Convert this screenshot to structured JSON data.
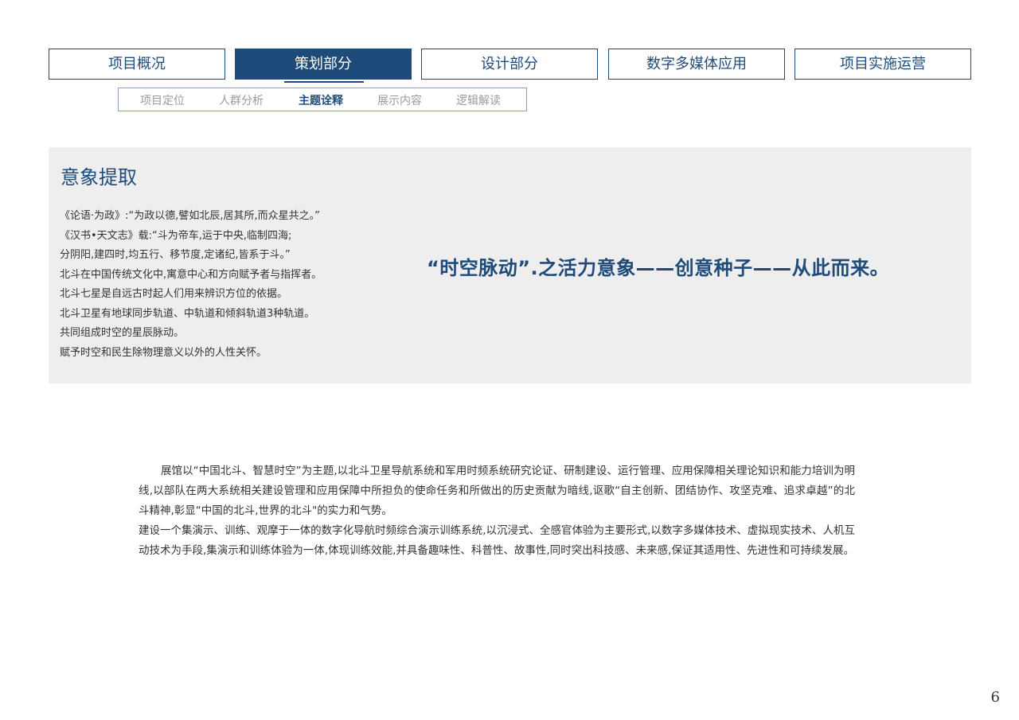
{
  "nav": {
    "tabs": [
      {
        "label": "项目概况"
      },
      {
        "label": "策划部分"
      },
      {
        "label": "设计部分"
      },
      {
        "label": "数字多媒体应用"
      },
      {
        "label": "项目实施运营"
      }
    ],
    "active_tab": "策划部分"
  },
  "subnav": {
    "items": [
      {
        "label": "项目定位"
      },
      {
        "label": "人群分析"
      },
      {
        "label": "主题诠释"
      },
      {
        "label": "展示内容"
      },
      {
        "label": "逻辑解读"
      }
    ],
    "active_item": "主题诠释"
  },
  "panel": {
    "title": "意象提取",
    "lines": [
      "《论语·为政》:“为政以德,譬如北辰,居其所,而众星共之。”",
      "《汉书•天文志》载:“斗为帝车,运于中央,临制四海;",
      "分阴阳,建四时,均五行、移节度,定诸纪,皆系于斗。”",
      "北斗在中国传统文化中,寓意中心和方向赋予者与指挥者。",
      "北斗七星是自远古时起人们用来辨识方位的依据。",
      "北斗卫星有地球同步轨道、中轨道和倾斜轨道3种轨道。",
      "共同组成时空的星辰脉动。",
      "赋予时空和民生除物理意义以外的人性关怀。"
    ],
    "slogan": "“时空脉动”.之活力意象——创意种子——从此而来。"
  },
  "body": {
    "paragraph1": "展馆以“中国北斗、智慧时空”为主题,以北斗卫星导航系统和军用时频系统研究论证、研制建设、运行管理、应用保障相关理论知识和能力培训为明线,以部队在两大系统相关建设管理和应用保障中所担负的使命任务和所做出的历史贡献为暗线,讴歌“自主创新、团结协作、攻坚克难、追求卓越”的北斗精神,彰显“中国的北斗,世界的北斗\"的实力和气势。",
    "paragraph2": "建设一个集演示、训练、观摩于一体的数字化导航时频综合演示训练系统,以沉浸式、全感官体验为主要形式,以数字多媒体技术、虚拟现实技术、人机互动技术为手段,集演示和训练体验为一体,体现训练效能,并具备趣味性、科普性、故事性,同时突出科技感、未来感,保证其适用性、先进性和可持续发展。"
  },
  "page_number": "6",
  "colors": {
    "accent": "#1f4b7a",
    "panel_bg": "#eeeeee",
    "inactive_subtab": "#9a9a9a"
  }
}
